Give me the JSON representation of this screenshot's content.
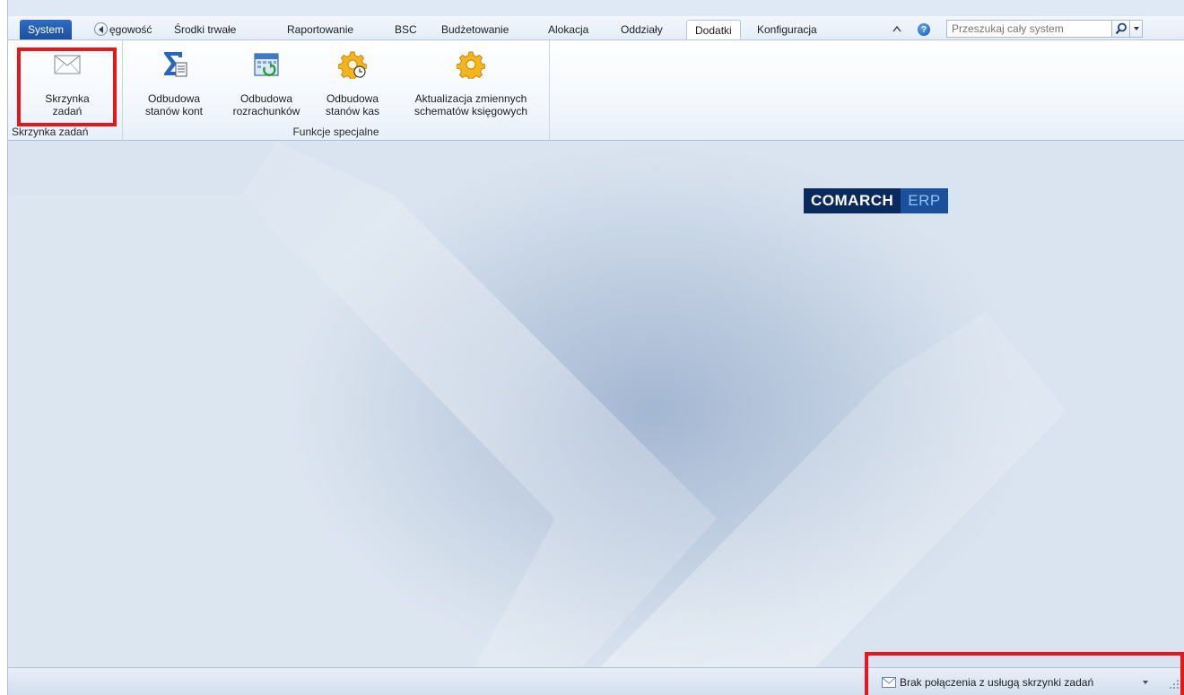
{
  "ribbon_tabs": {
    "system": "System",
    "items": [
      "ęgowość",
      "Środki trwałe",
      "Raportowanie",
      "BSC",
      "Budżetowanie",
      "Alokacja",
      "Oddziały",
      "Dodatki",
      "Konfiguracja"
    ],
    "active": "Dodatki"
  },
  "search": {
    "placeholder": "Przeszukaj cały system"
  },
  "icons": {
    "scroll_left": "circle-left-arrow-icon",
    "collapse": "caret-up-icon",
    "help": "help-icon",
    "search": "magnifier-icon"
  },
  "groups": {
    "mailbox": {
      "label": "Skrzynka zadań",
      "button": {
        "label_line1": "Skrzynka",
        "label_line2": "zadań",
        "icon": "envelope-icon"
      }
    },
    "special": {
      "label": "Funkcje specjalne",
      "buttons": [
        {
          "label_line1": "Odbudowa",
          "label_line2": "stanów kont",
          "icon": "sigma-document-icon"
        },
        {
          "label_line1": "Odbudowa",
          "label_line2": "rozrachunków",
          "icon": "calendar-refresh-icon"
        },
        {
          "label_line1": "Odbudowa",
          "label_line2": "stanów kas",
          "icon": "gear-clock-icon"
        },
        {
          "label_line1": "Aktualizacja zmiennych",
          "label_line2": "schematów księgowych",
          "icon": "gear-icon"
        }
      ]
    }
  },
  "logo": {
    "part1": "COMARCH",
    "part2": "ERP"
  },
  "statusbar": {
    "text": "Brak połączenia z usługą skrzynki zadań"
  },
  "colors": {
    "highlight": "#e8161b",
    "system_tab": "#1f57aa",
    "logo_dark": "#0a2a5e",
    "logo_blue": "#1c4f9c"
  }
}
